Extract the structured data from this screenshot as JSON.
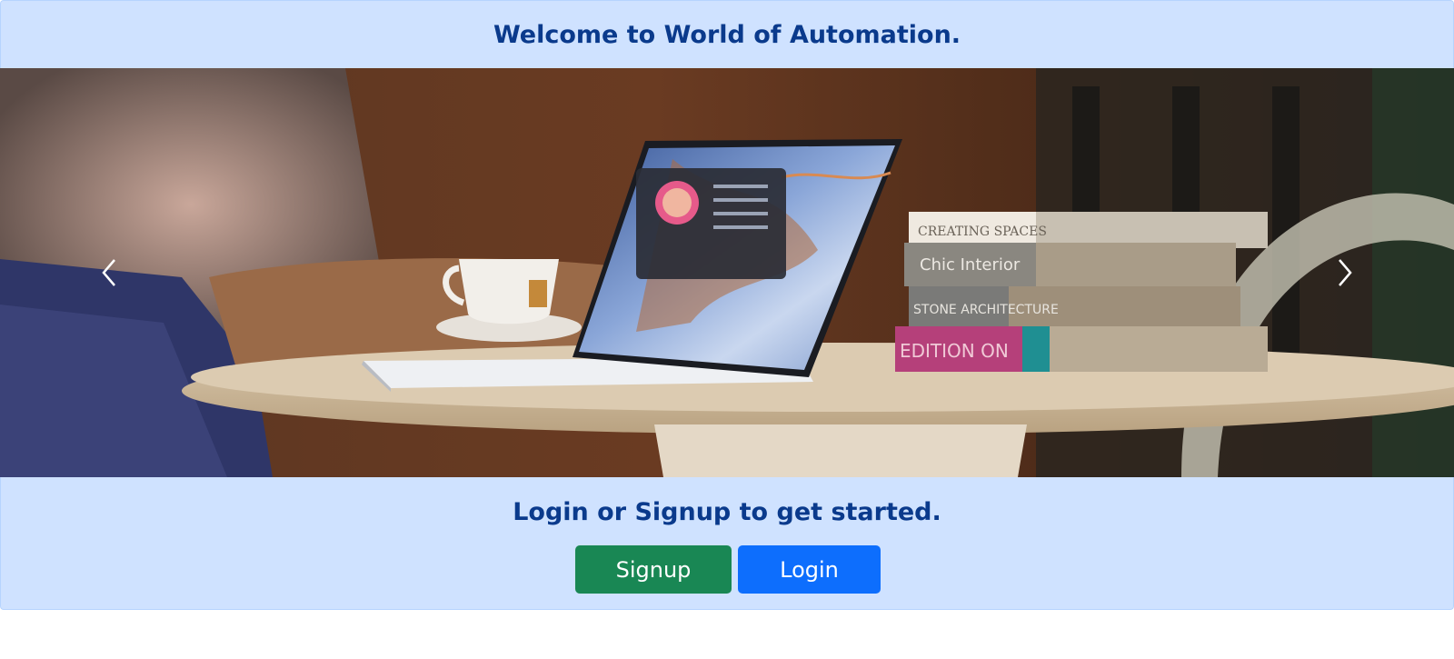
{
  "header": {
    "title": "Welcome to World of Automation."
  },
  "carousel": {
    "slide_alt": "laptop on coffee table",
    "prev_icon": "chevron-left-icon",
    "next_icon": "chevron-right-icon",
    "book_titles": [
      "CREATING SPACES",
      "Chic Interior",
      "STONE ARCHITECTURE",
      "EDITION ON"
    ]
  },
  "cta": {
    "heading": "Login or Signup to get started.",
    "signup_label": "Signup",
    "login_label": "Login"
  },
  "colors": {
    "banner_bg": "#cfe2ff",
    "heading_text": "#0a3a8c",
    "signup": "#198754",
    "login": "#0d6efd"
  }
}
